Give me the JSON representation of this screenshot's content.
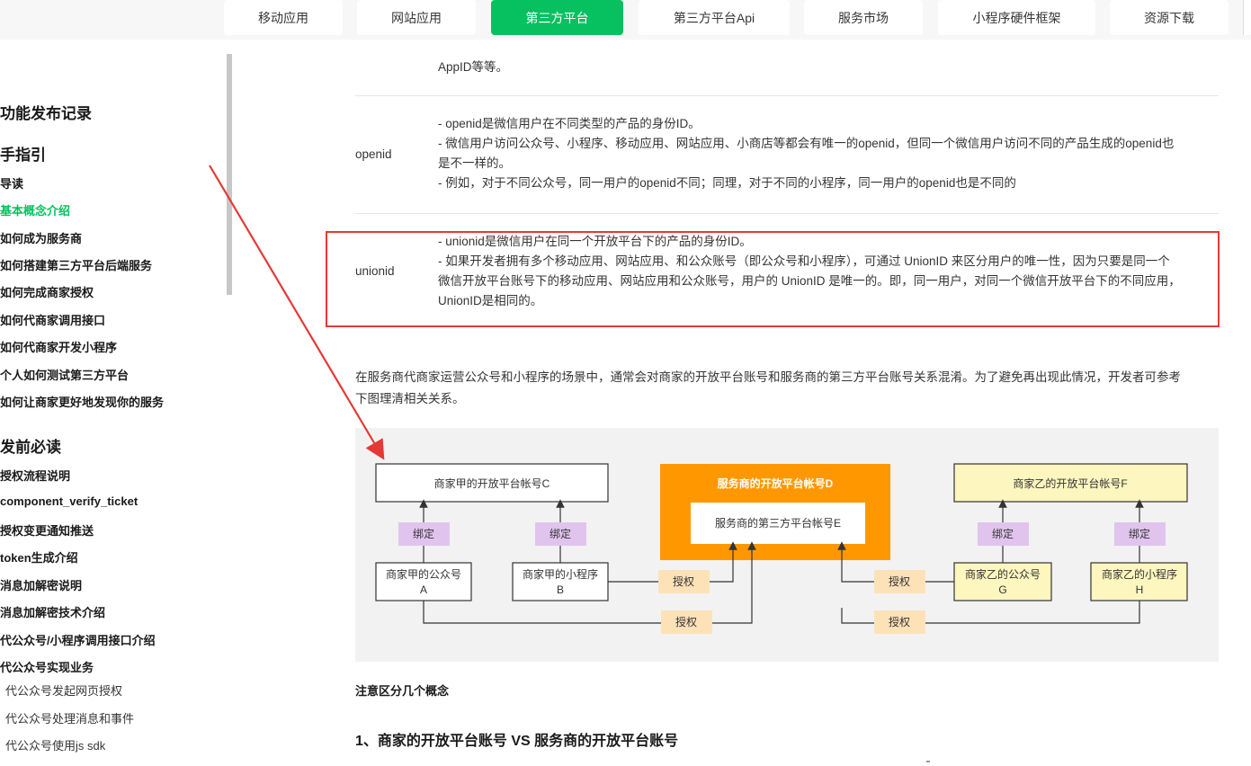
{
  "topnav": {
    "tabs": [
      {
        "label": "移动应用"
      },
      {
        "label": "网站应用"
      },
      {
        "label": "第三方平台",
        "active": true
      },
      {
        "label": "第三方平台Api"
      },
      {
        "label": "服务市场"
      },
      {
        "label": "小程序硬件框架"
      },
      {
        "label": "资源下载"
      }
    ],
    "active_color": "#07c160"
  },
  "sidebar": {
    "items": [
      {
        "label": "功能发布记录",
        "level": "heading"
      },
      {
        "label": "手指引",
        "level": "heading"
      },
      {
        "label": "导读",
        "level": "item"
      },
      {
        "label": "基本概念介绍",
        "level": "item",
        "active": true
      },
      {
        "label": "如何成为服务商",
        "level": "item"
      },
      {
        "label": "如何搭建第三方平台后端服务",
        "level": "item"
      },
      {
        "label": "如何完成商家授权",
        "level": "item"
      },
      {
        "label": "如何代商家调用接口",
        "level": "item"
      },
      {
        "label": "如何代商家开发小程序",
        "level": "item"
      },
      {
        "label": "个人如何测试第三方平台",
        "level": "item"
      },
      {
        "label": "如何让商家更好地发现你的服务",
        "level": "item"
      },
      {
        "label": "发前必读",
        "level": "heading"
      },
      {
        "label": "授权流程说明",
        "level": "item"
      },
      {
        "label": "component_verify_ticket",
        "level": "item"
      },
      {
        "label": "授权变更通知推送",
        "level": "item"
      },
      {
        "label": "token生成介绍",
        "level": "item"
      },
      {
        "label": "消息加解密说明",
        "level": "item"
      },
      {
        "label": "消息加解密技术介绍",
        "level": "item"
      },
      {
        "label": "代公众号/小程序调用接口介绍",
        "level": "item"
      },
      {
        "label": "代公众号实现业务",
        "level": "item"
      },
      {
        "label": "代公众号发起网页授权",
        "level": "sub"
      },
      {
        "label": "代公众号处理消息和事件",
        "level": "sub"
      },
      {
        "label": "代公众号使用js sdk",
        "level": "sub"
      }
    ]
  },
  "table": {
    "partial_top": "AppID等等。",
    "rows": [
      {
        "term": "openid",
        "lines": [
          "- openid是微信用户在不同类型的产品的身份ID。",
          "- 微信用户访问公众号、小程序、移动应用、网站应用、小商店等都会有唯一的openid，但同一个微信用户访问不同的产品生成的openid也",
          "是不一样的。",
          "- 例如，对于不同公众号，同一用户的openid不同；同理，对于不同的小程序，同一用户的openid也是不同的"
        ]
      },
      {
        "term": "unionid",
        "lines": [
          "- unionid是微信用户在同一个开放平台下的产品的身份ID。",
          "- 如果开发者拥有多个移动应用、网站应用、和公众账号（即公众号和小程序），可通过 UnionID 来区分用户的唯一性，因为只要是同一个",
          "微信开放平台账号下的移动应用、网站应用和公众账号，用户的 UnionID 是唯一的。即，同一用户，对同一个微信开放平台下的不同应用，",
          "UnionID是相同的。"
        ]
      }
    ]
  },
  "paragraph": [
    "在服务商代商家运营公众号和小程序的场景中，通常会对商家的开放平台账号和服务商的第三方平台账号关系混淆。为了避免再出现此情况，开发者可参考",
    "下图理清相关关系。"
  ],
  "diagram": {
    "accountC": "商家甲的开放平台帐号C",
    "accountD": "服务商的开放平台帐号D",
    "platformE": "服务商的第三方平台帐号E",
    "accountF": "商家乙的开放平台帐号F",
    "bind": "绑定",
    "auth": "授权",
    "A_line1": "商家甲的公众号",
    "A_line2": "A",
    "B_line1": "商家甲的小程序",
    "B_line2": "B",
    "G_line1": "商家乙的公众号",
    "G_line2": "G",
    "H_line1": "商家乙的小程序",
    "H_line2": "H",
    "colors": {
      "orange": "#ff9800",
      "yellow": "#fdf6bf",
      "purple": "#e1c4ee",
      "peach": "#fde2b8"
    }
  },
  "note": "注意区分几个概念",
  "heading3": "1、商家的开放平台账号 VS 服务商的开放平台账号",
  "annotation_color": "#e53935"
}
